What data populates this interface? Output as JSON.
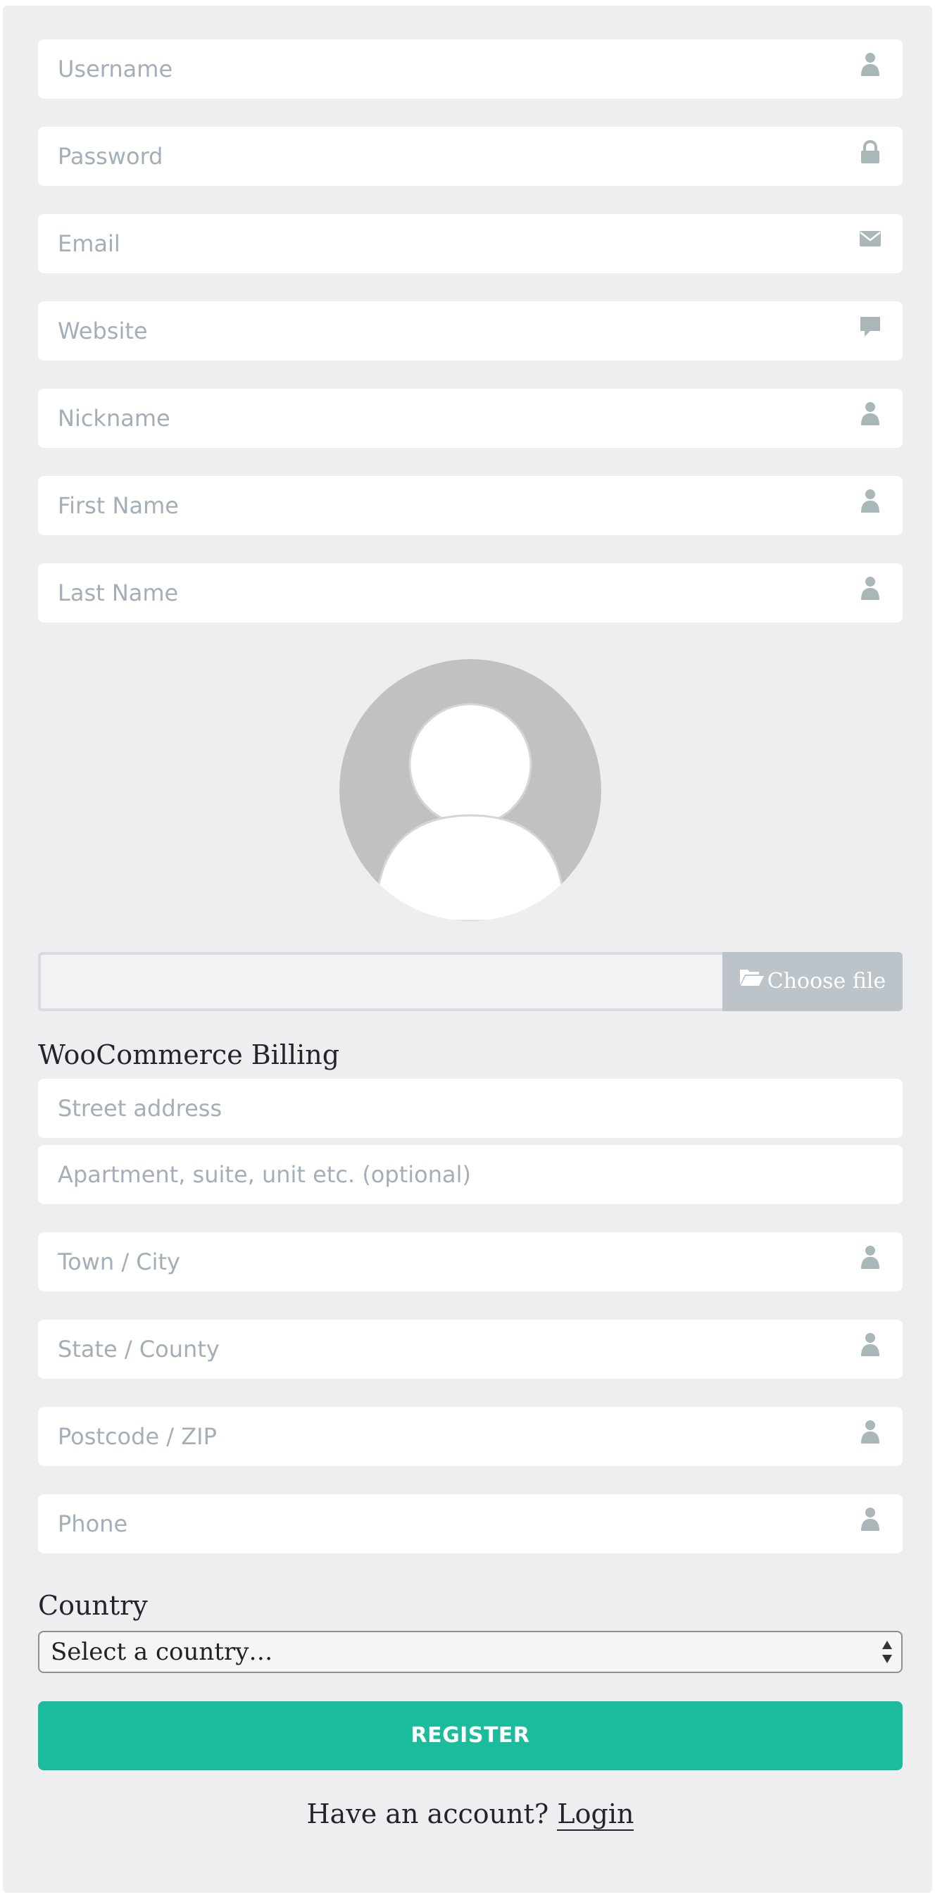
{
  "form": {
    "fields": {
      "username": "Username",
      "password": "Password",
      "email": "Email",
      "website": "Website",
      "nickname": "Nickname",
      "first_name": "First Name",
      "last_name": "Last Name"
    },
    "file": {
      "button_label": "Choose file"
    },
    "billing": {
      "title": "WooCommerce Billing",
      "street": "Street address",
      "apartment": "Apartment, suite, unit etc. (optional)",
      "city": "Town / City",
      "state": "State / County",
      "postcode": "Postcode / ZIP",
      "phone": "Phone"
    },
    "country": {
      "label": "Country",
      "selected": "Select a country…"
    },
    "register_label": "REGISTER",
    "login_prompt": "Have an account?",
    "login_link": "Login"
  },
  "icons": {
    "user": "user-icon",
    "lock": "lock-icon",
    "envelope": "envelope-icon",
    "comment": "comment-icon",
    "folder": "folder-open-icon"
  },
  "colors": {
    "panel": "#edeef0",
    "accent": "#1abc9c",
    "placeholder": "#a4aeb8",
    "icon": "#aab7b8",
    "file_button": "#bcc3c9"
  }
}
